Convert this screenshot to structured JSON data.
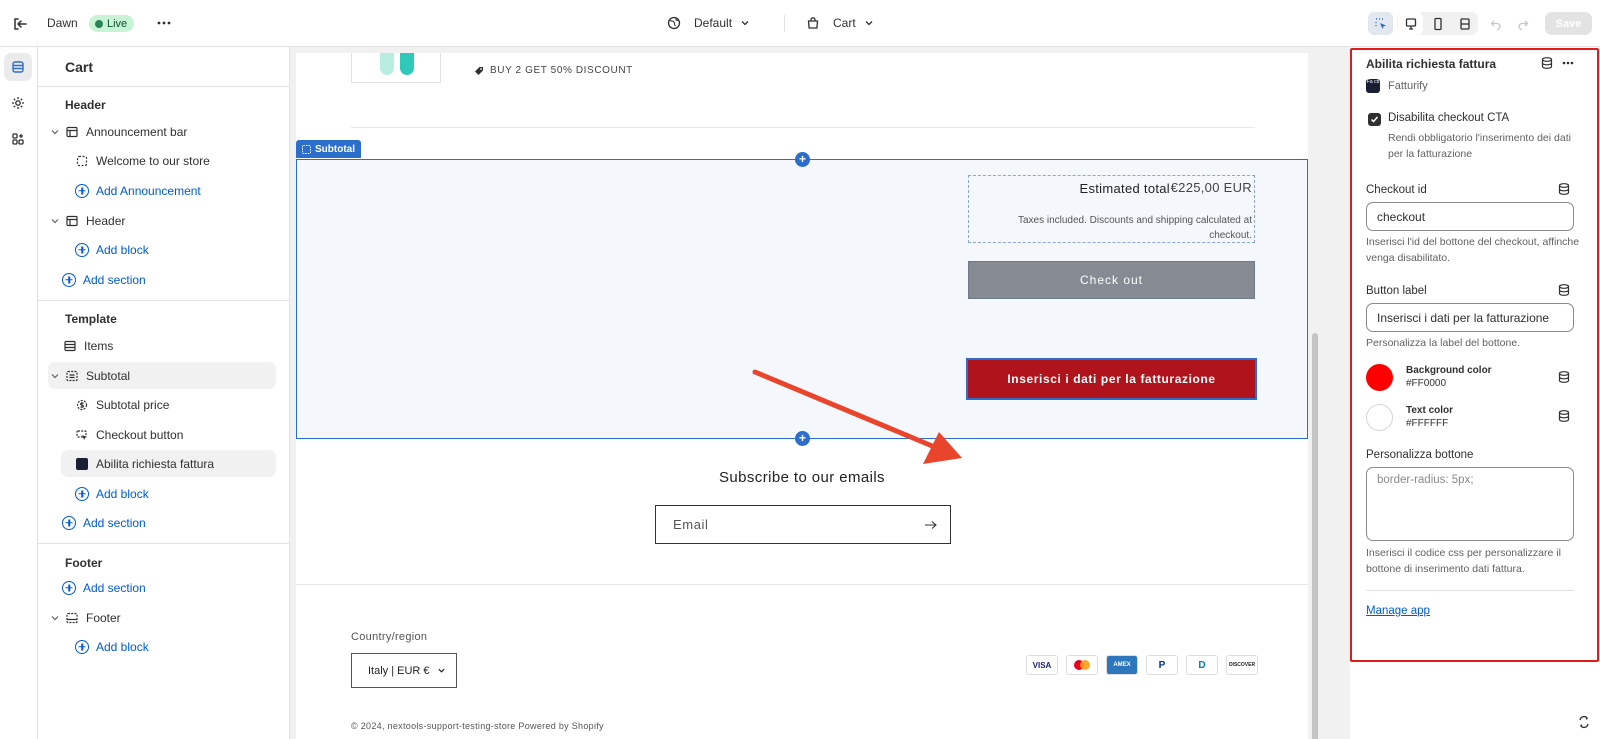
{
  "topbar": {
    "theme_name": "Dawn",
    "live_badge": "Live",
    "view_mode": "Default",
    "template": "Cart",
    "save_label": "Save"
  },
  "sidebar": {
    "title": "Cart",
    "header_group": "Header",
    "announcement_bar": "Announcement bar",
    "welcome_block": "Welcome to our store",
    "add_announcement": "Add Announcement",
    "header_section": "Header",
    "add_block_1": "Add block",
    "add_section_1": "Add section",
    "template_group": "Template",
    "items": "Items",
    "subtotal": "Subtotal",
    "subtotal_price": "Subtotal price",
    "checkout_button": "Checkout button",
    "invoice_block": "Abilita richiesta fattura",
    "add_block_2": "Add block",
    "add_section_2": "Add section",
    "footer_group": "Footer",
    "add_section_3": "Add section",
    "footer_section": "Footer",
    "add_block_3": "Add block"
  },
  "preview": {
    "discount": "BUY 2 GET 50% DISCOUNT",
    "section_tag": "Subtotal",
    "estimated_label": "Estimated total",
    "estimated_value": "€225,00 EUR",
    "taxes_note": "Taxes included. Discounts and shipping calculated at checkout.",
    "checkout_label": "Check out",
    "invoice_label": "Inserisci i dati per la fatturazione",
    "subscribe_title": "Subscribe to our emails",
    "email_placeholder": "Email",
    "country_label": "Country/region",
    "country_value": "Italy | EUR €",
    "payments": [
      "VISA",
      "MC",
      "AMEX",
      "P",
      "D",
      "DISCOVER"
    ],
    "copyright": "© 2024, nextools-support-testing-store Powered by Shopify"
  },
  "settings": {
    "title": "Abilita richiesta fattura",
    "app_name": "Fatturify",
    "app_icon_text": "Fa cti",
    "checkbox_label": "Disabilita checkout CTA",
    "checkbox_help": "Rendi obbligatorio l'inserimento dei dati per la fatturazione",
    "checkout_id_label": "Checkout id",
    "checkout_id_value": "checkout",
    "checkout_id_help": "Inserisci l'id del bottone del checkout, affinche venga disabilitato.",
    "button_label_label": "Button label",
    "button_label_value": "Inserisci i dati per la fatturazione",
    "button_label_help": "Personalizza la label del bottone.",
    "bg_color_name": "Background color",
    "bg_color_hex": "#FF0000",
    "text_color_name": "Text color",
    "text_color_hex": "#FFFFFF",
    "custom_label": "Personalizza bottone",
    "custom_placeholder": "border-radius: 5px;",
    "custom_help": "Inserisci il codice css per personalizzare il bottone di inserimento dati fattura.",
    "manage_app": "Manage app"
  },
  "colors": {
    "accent": "#2c6ecb",
    "invoice_button": "#b0131b",
    "background_swatch": "#FF0000",
    "text_swatch": "#FFFFFF",
    "annotation": "#e8452c"
  }
}
